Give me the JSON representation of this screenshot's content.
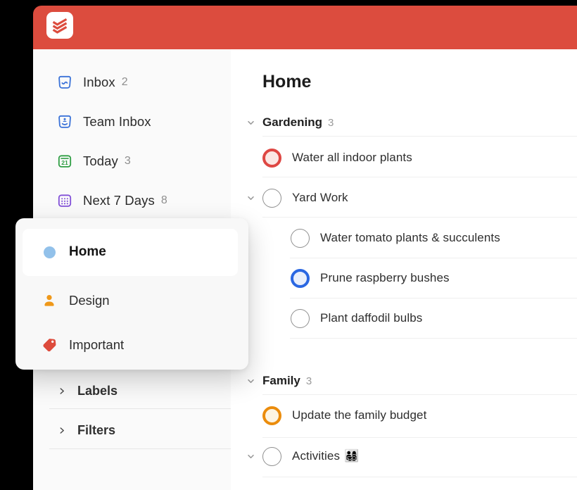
{
  "app": {
    "name": "Todoist",
    "colors": {
      "brand_red": "#dc4c3e",
      "inbox_blue": "#3a72d8",
      "today_green": "#2f9e44",
      "next7_purple": "#8250d8",
      "selected_dot_blue": "#92c1ea",
      "design_orange": "#ef9819",
      "important_red": "#dd4b3c",
      "checkbox_red": "#de4743",
      "checkbox_blue": "#2a67e2",
      "checkbox_orange": "#eb8c0c"
    }
  },
  "sidebar": {
    "items": [
      {
        "icon": "inbox-icon",
        "label": "Inbox",
        "count": "2"
      },
      {
        "icon": "team-inbox-icon",
        "label": "Team Inbox",
        "count": ""
      },
      {
        "icon": "today-calendar-icon",
        "label": "Today",
        "count": "3"
      },
      {
        "icon": "next-7-days-icon",
        "label": "Next 7 Days",
        "count": "8"
      }
    ],
    "collapsed_sections": [
      {
        "label": "Labels"
      },
      {
        "label": "Filters"
      }
    ]
  },
  "popup": {
    "items": [
      {
        "icon": "project-color-dot",
        "label": "Home",
        "selected": true
      },
      {
        "icon": "person-icon",
        "label": "Design",
        "selected": false
      },
      {
        "icon": "tag-icon",
        "label": "Important",
        "selected": false
      }
    ]
  },
  "main": {
    "title": "Home",
    "sections": [
      {
        "name": "Gardening",
        "count": "3",
        "tasks": [
          {
            "title": "Water all indoor plants",
            "checkbox": "red"
          },
          {
            "title": "Yard Work",
            "checkbox": "gray",
            "subtasks": [
              {
                "title": "Water tomato plants & succulents",
                "checkbox": "gray"
              },
              {
                "title": "Prune raspberry bushes",
                "checkbox": "blue"
              },
              {
                "title": "Plant daffodil bulbs",
                "checkbox": "gray"
              }
            ]
          }
        ]
      },
      {
        "name": "Family",
        "count": "3",
        "tasks": [
          {
            "title": "Update the family budget",
            "checkbox": "orange"
          },
          {
            "title": "Activities",
            "emoji": "👨‍👩‍👧‍👦",
            "checkbox": "gray"
          }
        ]
      }
    ]
  }
}
